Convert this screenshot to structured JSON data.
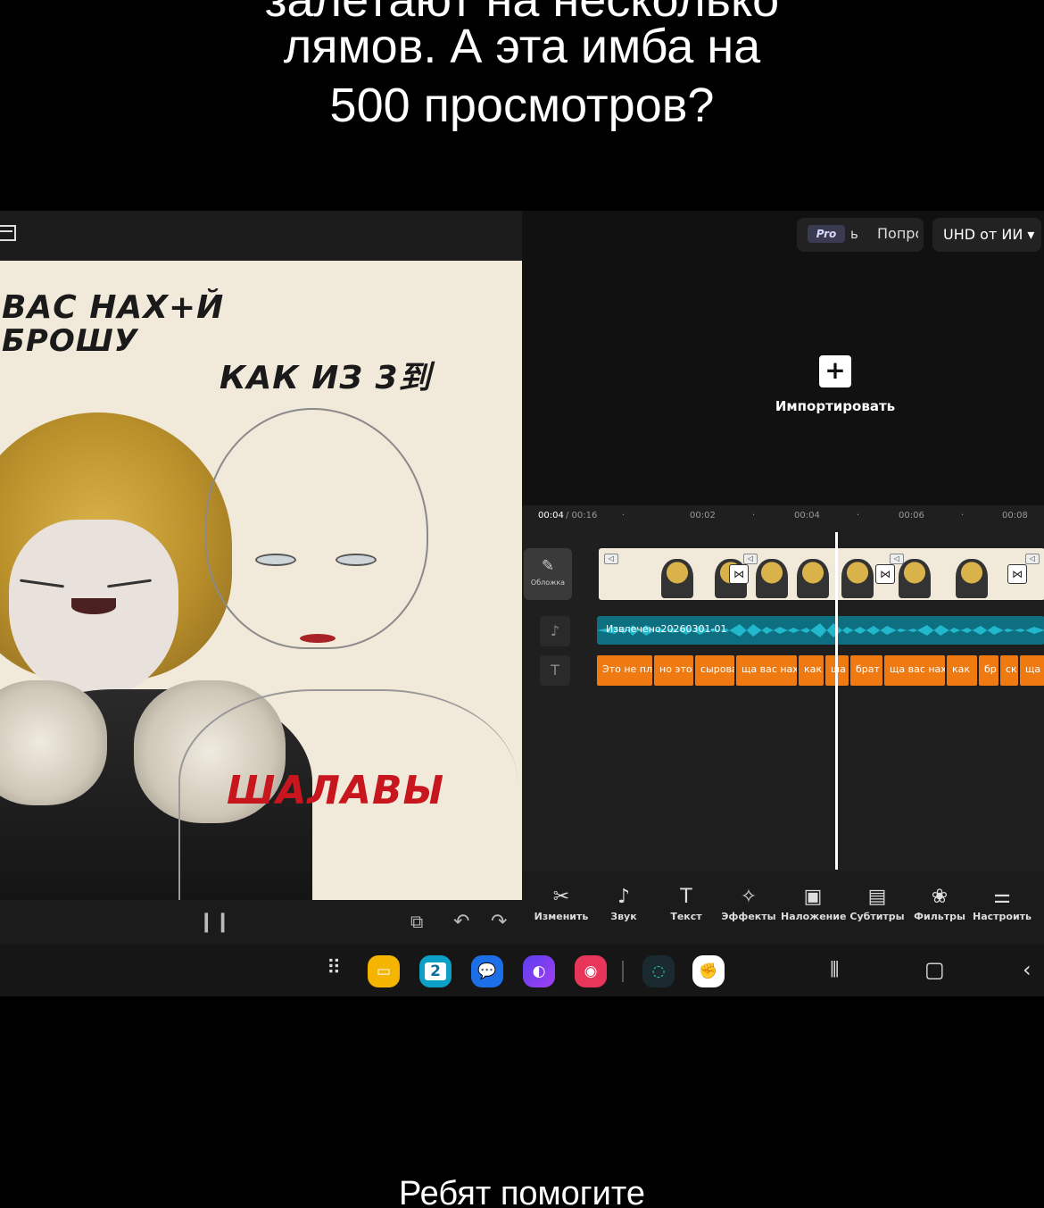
{
  "caption": {
    "line0": "залетают на несколько",
    "line1": "лямов. А эта имба на",
    "line2": "500 просмотров?",
    "bottom": "Ребят помогите"
  },
  "artwork": {
    "text1": "ВАС НАХ+Й",
    "text2": "БРОШУ",
    "text3": "КАК ИЗ 3到",
    "text4": "ШАЛАВЫ"
  },
  "editor": {
    "pro_badge": "Pro",
    "pro_suffix": "ь",
    "popular": "Попрс",
    "uhd": "UHD от ИИ ▾",
    "import_label": "Импортировать",
    "time_current": "00:04",
    "time_total": "/ 00:16",
    "ticks": [
      "00:02",
      "00:04",
      "00:06",
      "00:08"
    ],
    "cover_label": "Обложка",
    "audio_label": "Извлечено20260301-01",
    "text_clips": [
      "Это не пл",
      "но это",
      "сырова",
      "ща вас нах",
      "как",
      "ша",
      "брат",
      "ща вас нах",
      "как",
      "бр",
      "ск",
      "ща в"
    ],
    "tools": [
      {
        "icon": "✂",
        "label": "Изменить"
      },
      {
        "icon": "♪",
        "label": "Звук"
      },
      {
        "icon": "T",
        "label": "Текст"
      },
      {
        "icon": "✧",
        "label": "Эффекты"
      },
      {
        "icon": "▣",
        "label": "Наложение"
      },
      {
        "icon": "▤",
        "label": "Субтитры"
      },
      {
        "icon": "❀",
        "label": "Фильтры"
      },
      {
        "icon": "⚌",
        "label": "Настроить"
      }
    ]
  },
  "taskbar": {
    "calendar_day": "2"
  },
  "colors": {
    "text_track": "#ef7a12",
    "audio_track": "#0d6f80",
    "waveform": "#21b7cc"
  }
}
